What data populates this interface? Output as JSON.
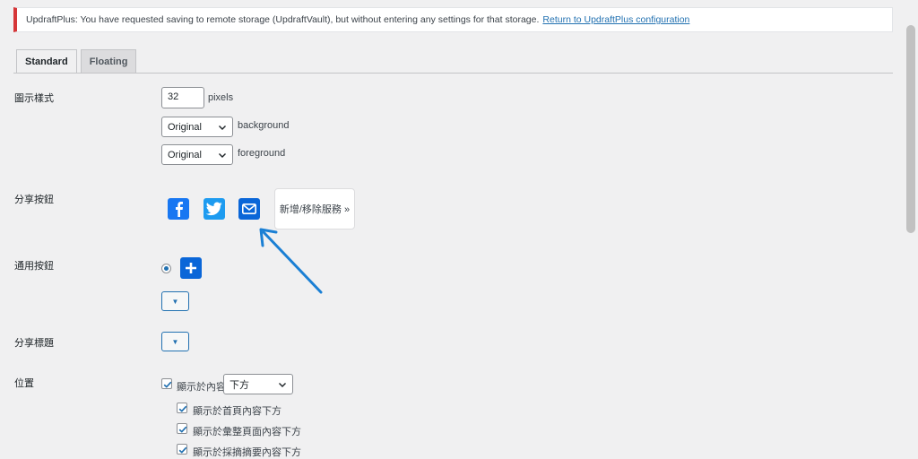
{
  "notice": {
    "text": "UpdraftPlus: You have requested saving to remote storage (UpdraftVault), but without entering any settings for that storage.",
    "link": "Return to UpdraftPlus configuration"
  },
  "tabs": [
    {
      "label": "Standard",
      "active": true
    },
    {
      "label": "Floating",
      "active": false
    }
  ],
  "icon_style": {
    "label": "圖示樣式",
    "size_value": "32",
    "size_unit": "pixels",
    "background_select": "Original",
    "background_label": "background",
    "foreground_select": "Original",
    "foreground_label": "foreground"
  },
  "share_buttons": {
    "label": "分享按鈕",
    "icons": [
      "facebook-icon",
      "twitter-icon",
      "email-icon"
    ],
    "add_remove_label": "新增/移除服務 »"
  },
  "universal_button": {
    "label": "通用按鈕"
  },
  "share_title": {
    "label": "分享標題"
  },
  "position": {
    "label": "位置",
    "show_in_content_label": "顯示於內容",
    "show_in_content_select": "下方",
    "options": [
      "顯示於首頁內容下方",
      "顯示於彙整頁面內容下方",
      "顯示於採摘摘要內容下方"
    ]
  },
  "colors": {
    "accent": "#2271b1",
    "facebook": "#1877f2",
    "twitter": "#1d9bf0",
    "email": "#0a66d8",
    "error": "#d63638",
    "annotation_arrow": "#1a7fd4"
  }
}
